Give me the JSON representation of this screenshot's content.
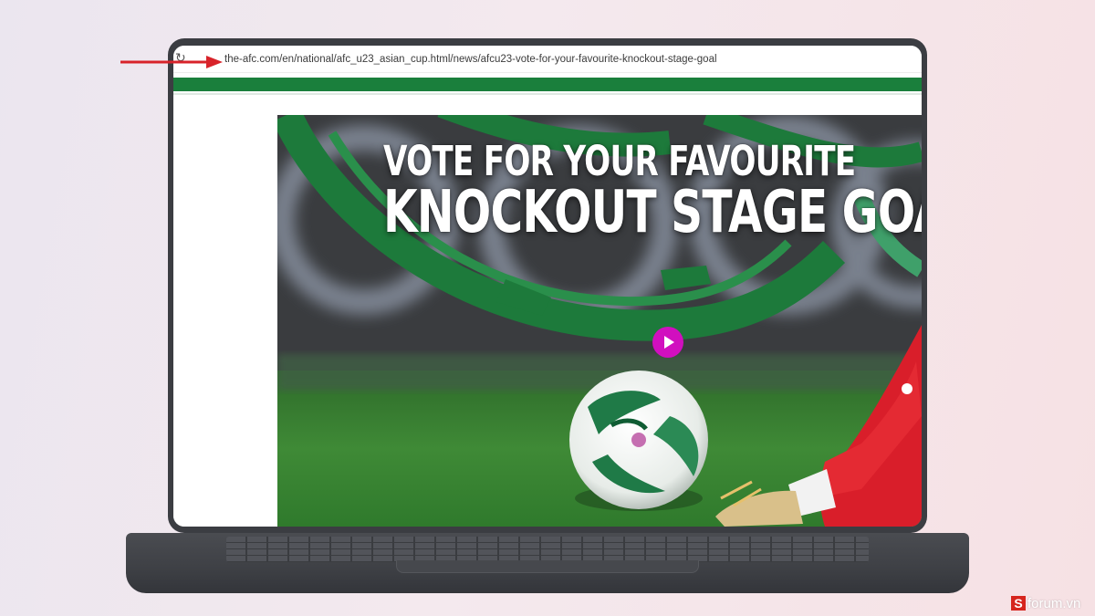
{
  "browser": {
    "url": "the-afc.com/en/national/afc_u23_asian_cup.html/news/afcu23-vote-for-your-favourite-knockout-stage-goal",
    "reload_icon": "reload-icon"
  },
  "hero": {
    "title_line1": "VOTE FOR YOUR FAVOURITE",
    "title_line2": "KNOCKOUT STAGE GOAL",
    "play_icon": "play-icon"
  },
  "annotation": {
    "arrow_color": "#d8232a"
  },
  "watermark": {
    "badge": "S",
    "text": "forum.vn"
  },
  "colors": {
    "site_green": "#1a7f3c",
    "play_magenta": "#d10fbf",
    "laptop_body": "#3b3d42"
  }
}
